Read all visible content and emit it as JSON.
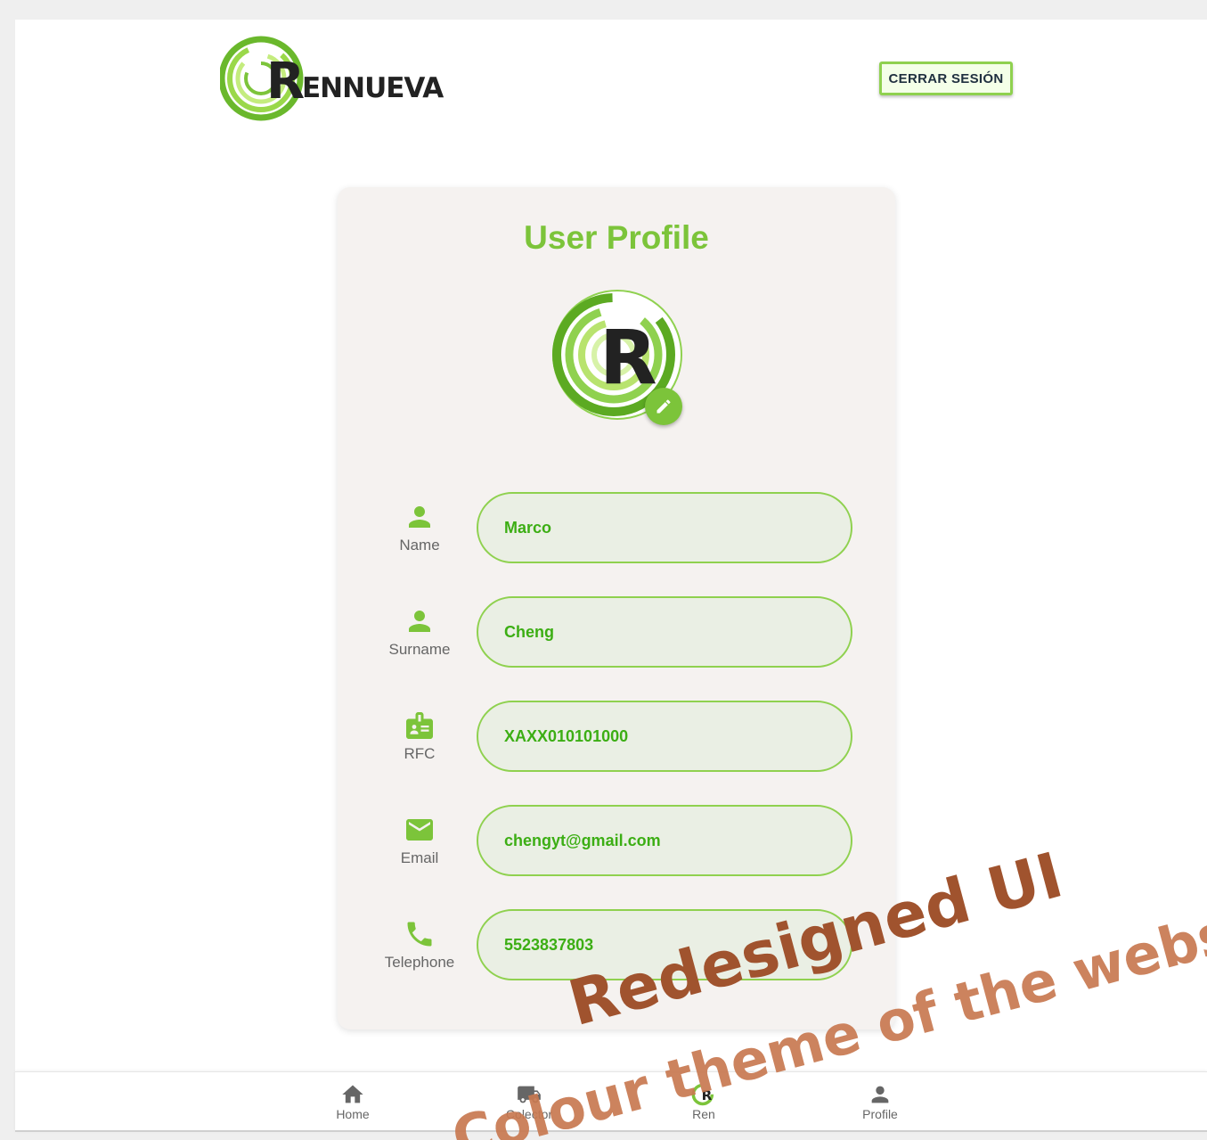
{
  "header": {
    "brand_name": "RENNUEVA",
    "logout_label": "CERRAR SESIÓN"
  },
  "profile": {
    "title": "User Profile",
    "fields": [
      {
        "label": "Name",
        "value": "Marco",
        "icon": "person-icon"
      },
      {
        "label": "Surname",
        "value": "Cheng",
        "icon": "person-icon"
      },
      {
        "label": "RFC",
        "value": "XAXX010101000",
        "icon": "id-badge-icon"
      },
      {
        "label": "Email",
        "value": "chengyt@gmail.com",
        "icon": "mail-icon"
      },
      {
        "label": "Telephone",
        "value": "5523837803",
        "icon": "phone-icon"
      }
    ]
  },
  "nav": {
    "items": [
      {
        "label": "Home",
        "icon": "home-icon"
      },
      {
        "label": "Colector",
        "icon": "truck-icon"
      },
      {
        "label": "Ren",
        "icon": "ren-logo-icon"
      },
      {
        "label": "Profile",
        "icon": "person-icon"
      }
    ]
  },
  "watermark": {
    "line1": "Redesigned UI",
    "line2": "Colour theme of the website"
  },
  "colors": {
    "accent": "#7cc43a",
    "field_border": "#8fd14f",
    "field_text": "#3cae14",
    "field_bg": "#eaefe4",
    "card_bg": "#f5f2f0",
    "watermark": "#a0532e"
  }
}
